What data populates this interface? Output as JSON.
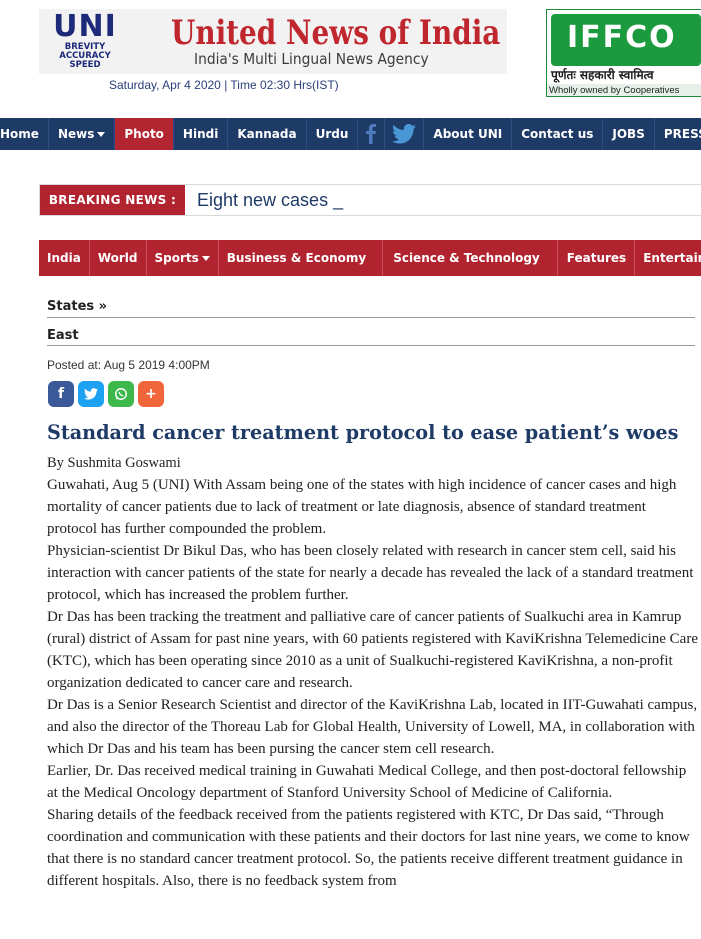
{
  "header": {
    "logo_mark": "UNI",
    "logo_tag1": "BREVITY",
    "logo_tag2": "ACCURACY",
    "logo_tag3": "SPEED",
    "site_name": "United News of India",
    "site_sub": "India's Multi Lingual News Agency",
    "date_line": "Saturday, Apr 4 2020 | Time 02:30 Hrs(IST)"
  },
  "ad": {
    "brand": "IFFCO",
    "hindi": "पूर्णतः सहकारी स्वामित्व",
    "foot": "Wholly owned by Cooperatives"
  },
  "topnav": {
    "home": "Home",
    "news": "News",
    "photo": "Photo",
    "hindi": "Hindi",
    "kannada": "Kannada",
    "urdu": "Urdu",
    "about": "About UNI",
    "contact": "Contact us",
    "jobs": "JOBS",
    "press": "PRESS"
  },
  "breaking": {
    "label": "BREAKING NEWS :",
    "text": "Eight new cases _"
  },
  "catnav": {
    "india": "India",
    "world": "World",
    "sports": "Sports",
    "business": "Business & Economy",
    "science": "Science & Technology",
    "features": "Features",
    "entertainment": "Entertainment"
  },
  "crumbs": {
    "states": "States »",
    "east": "East"
  },
  "posted": "Posted at: Aug 5 2019 4:00PM",
  "share": {
    "facebook": "f",
    "plus": "+"
  },
  "article": {
    "headline": "Standard cancer treatment protocol to ease patient’s woes",
    "byline": "By Sushmita Goswami",
    "paragraphs": [
      "Guwahati, Aug 5 (UNI) With Assam being one of the states with high incidence of cancer cases and high mortality of cancer patients due to lack of treatment or late diagnosis, absence of standard treatment protocol has further compounded the problem.",
      "Physician-scientist Dr Bikul Das, who has been closely related with research in cancer stem cell, said his interaction with cancer patients of the state for nearly a decade has revealed the lack of a standard treatment protocol, which has increased the problem further.",
      "Dr Das has been tracking the treatment and palliative care of cancer patients of Sualkuchi area in Kamrup (rural) district of Assam for past nine years, with 60 patients registered with KaviKrishna Telemedicine Care (KTC), which has been operating since 2010 as a unit of Sualkuchi-registered KaviKrishna, a non-profit organization dedicated to cancer care and research.",
      "Dr Das is a Senior Research Scientist and director of the KaviKrishna Lab, located in IIT-Guwahati campus, and also the director of the Thoreau Lab for Global Health, University of Lowell, MA, in collaboration with which Dr Das and his team has been pursing the cancer stem cell research.",
      "Earlier, Dr. Das received medical training in Guwahati Medical College, and then post-doctoral fellowship at the Medical Oncology department of Stanford University School of Medicine of California.",
      "Sharing details of the feedback received from the patients registered with KTC, Dr Das said, “Through coordination and communication with these patients and their doctors for last nine years, we come to know that there is no standard cancer treatment protocol. So, the patients receive different treatment guidance in different hospitals. Also, there is no feedback system from"
    ]
  },
  "colors": {
    "navy": "#1e3a66",
    "red": "#b1242f",
    "headline": "#1e3a66"
  }
}
